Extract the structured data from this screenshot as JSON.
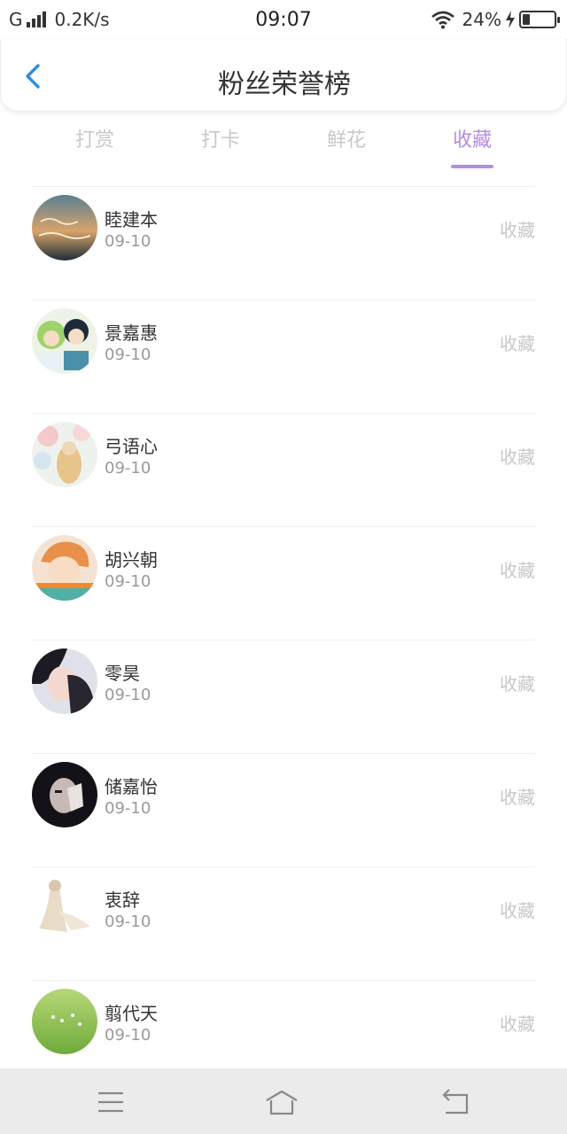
{
  "status_bar": {
    "network": "G",
    "speed": "0.2K/s",
    "time": "09:07",
    "battery": "24%",
    "battery_level": 0.24
  },
  "header": {
    "title": "粉丝荣誉榜"
  },
  "tabs": [
    {
      "label": "打赏",
      "active": false
    },
    {
      "label": "打卡",
      "active": false
    },
    {
      "label": "鲜花",
      "active": false
    },
    {
      "label": "收藏",
      "active": true
    }
  ],
  "colors": {
    "accent": "#b58de0",
    "back_icon": "#2a8ee0",
    "muted": "#c8c8c8"
  },
  "list": [
    {
      "name": "睦建本",
      "date": "09-10",
      "action": "收藏",
      "avatar": "avatar-hello-august"
    },
    {
      "name": "景嘉惠",
      "date": "09-10",
      "action": "收藏",
      "avatar": "avatar-anime-couple"
    },
    {
      "name": "弓语心",
      "date": "09-10",
      "action": "收藏",
      "avatar": "avatar-blossom-girl"
    },
    {
      "name": "胡兴朝",
      "date": "09-10",
      "action": "收藏",
      "avatar": "avatar-anime-boy"
    },
    {
      "name": "零昊",
      "date": "09-10",
      "action": "收藏",
      "avatar": "avatar-portrait"
    },
    {
      "name": "储嘉怡",
      "date": "09-10",
      "action": "收藏",
      "avatar": "avatar-dark-portrait"
    },
    {
      "name": "衷辞",
      "date": "09-10",
      "action": "收藏",
      "avatar": "avatar-figure-sketch"
    },
    {
      "name": "翦代天",
      "date": "09-10",
      "action": "收藏",
      "avatar": "avatar-green-field"
    }
  ]
}
